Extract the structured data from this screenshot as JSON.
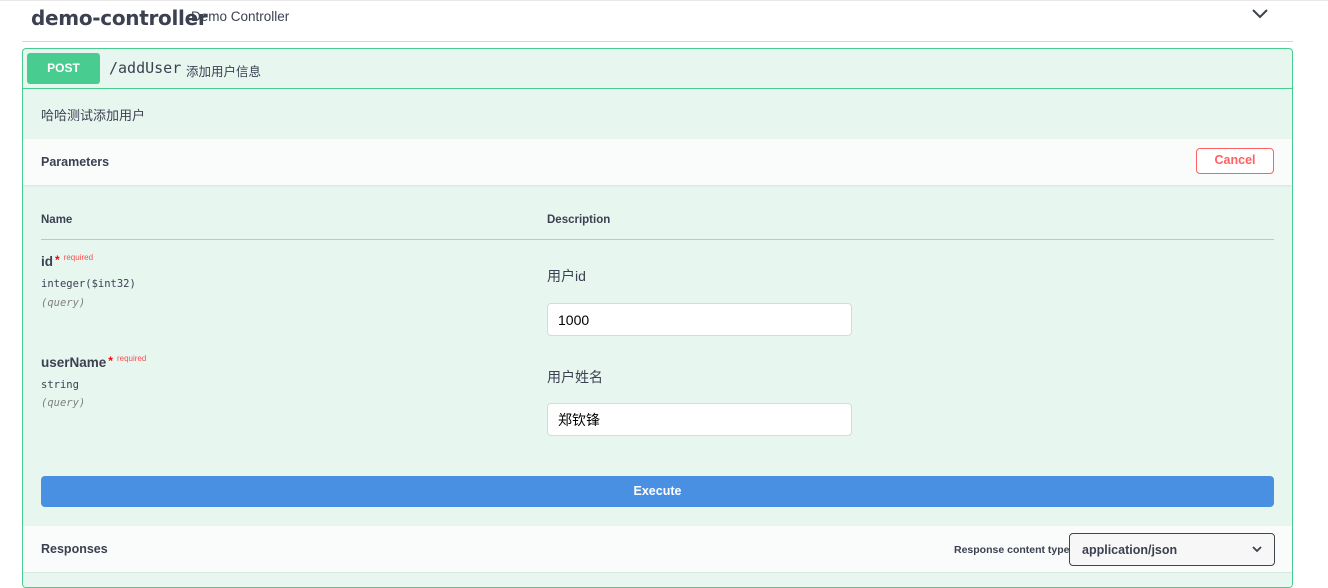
{
  "controller": {
    "name": "demo-controller",
    "description": "Demo Controller",
    "toggle_icon": "chevron-down-icon"
  },
  "operation": {
    "method": "POST",
    "path": "/addUser",
    "summary": "添加用户信息",
    "description": "哈哈测试添加用户",
    "accent_color": "#49cc90"
  },
  "parameters": {
    "title": "Parameters",
    "cancel_label": "Cancel",
    "col_name": "Name",
    "col_description": "Description",
    "items": [
      {
        "name": "id",
        "required_star": "*",
        "required_label": "required",
        "type": "integer($int32)",
        "in": "(query)",
        "label": "用户id",
        "value": "1000"
      },
      {
        "name": "userName",
        "required_star": "*",
        "required_label": "required",
        "type": "string",
        "in": "(query)",
        "label": "用户姓名",
        "value": "郑钦锋"
      }
    ],
    "execute_label": "Execute",
    "execute_color": "#4990e2"
  },
  "responses": {
    "title": "Responses",
    "content_type_label": "Response content type",
    "content_type_value": "application/json"
  }
}
